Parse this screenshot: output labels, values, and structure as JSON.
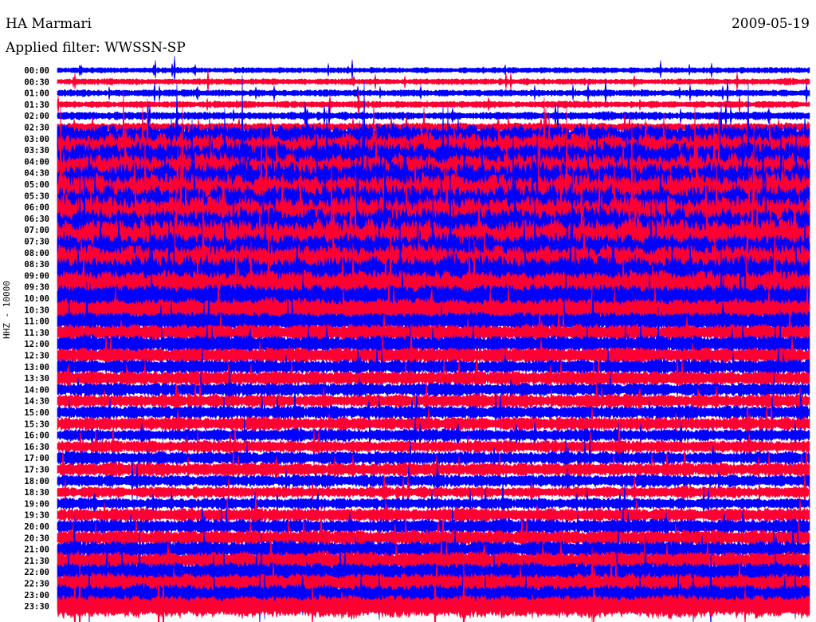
{
  "header": {
    "station": "HA Marmari",
    "filter": "Applied filter: WWSSN-SP",
    "date": "2009-05-19"
  },
  "chart_data": {
    "type": "line",
    "title": "HA Marmari",
    "subtitle": "Applied filter: WWSSN-SP",
    "ylabel": "HHZ - 10000",
    "xlabel": "",
    "grid": false,
    "colors": [
      "#0000ff",
      "#ff0033"
    ],
    "rows": [
      "00:00",
      "00:30",
      "01:00",
      "01:30",
      "02:00",
      "02:30",
      "03:00",
      "03:30",
      "04:00",
      "04:30",
      "05:00",
      "05:30",
      "06:00",
      "06:30",
      "07:00",
      "07:30",
      "08:00",
      "08:30",
      "09:00",
      "09:30",
      "10:00",
      "10:30",
      "11:00",
      "11:30",
      "12:00",
      "12:30",
      "13:00",
      "13:30",
      "14:00",
      "14:30",
      "15:00",
      "15:30",
      "16:00",
      "16:30",
      "17:00",
      "17:30",
      "18:00",
      "18:30",
      "19:00",
      "19:30",
      "20:00",
      "20:30",
      "21:00",
      "21:30",
      "22:00",
      "22:30",
      "23:00",
      "23:30"
    ],
    "relative_amplitude": [
      0.5,
      0.55,
      0.6,
      0.6,
      0.7,
      0.8,
      2.5,
      3,
      3.5,
      3.5,
      4,
      4,
      4,
      4,
      4,
      4,
      3.5,
      3.5,
      3.5,
      3,
      2.5,
      2,
      1.6,
      1.5,
      1.5,
      1.4,
      1.3,
      1.3,
      1.2,
      1.2,
      1.2,
      1.2,
      1.1,
      1.1,
      1.2,
      1.2,
      1.1,
      1.0,
      1.0,
      1.2,
      1.3,
      1.4,
      1.5,
      1.6,
      1.7,
      1.8,
      1.8,
      2.0
    ]
  }
}
